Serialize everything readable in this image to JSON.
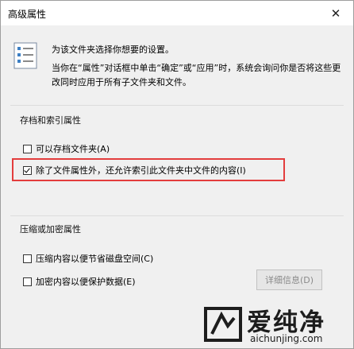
{
  "window": {
    "title": "高级属性"
  },
  "intro": {
    "line1": "为该文件夹选择你想要的设置。",
    "line2": "当你在“属性”对话框中单击“确定”或“应用”时，系统会询问你是否将这些更改同时应用于所有子文件夹和文件。"
  },
  "archive_group": {
    "title": "存档和索引属性",
    "options": [
      {
        "label": "可以存档文件夹(A)",
        "checked": false
      },
      {
        "label": "除了文件属性外，还允许索引此文件夹中文件的内容(I)",
        "checked": true
      }
    ]
  },
  "compress_group": {
    "title": "压缩或加密属性",
    "options": [
      {
        "label": "压缩内容以便节省磁盘空间(C)",
        "checked": false
      },
      {
        "label": "加密内容以便保护数据(E)",
        "checked": false
      }
    ],
    "details_button": "详细信息(D)"
  },
  "watermark": {
    "brand": "爱纯净",
    "url": "aichunjing.com"
  },
  "colors": {
    "highlight": "#e33d3d",
    "dialog_bg": "#f0f0f0"
  },
  "icons": {
    "close": "close-icon",
    "info": "settings-list-icon"
  }
}
